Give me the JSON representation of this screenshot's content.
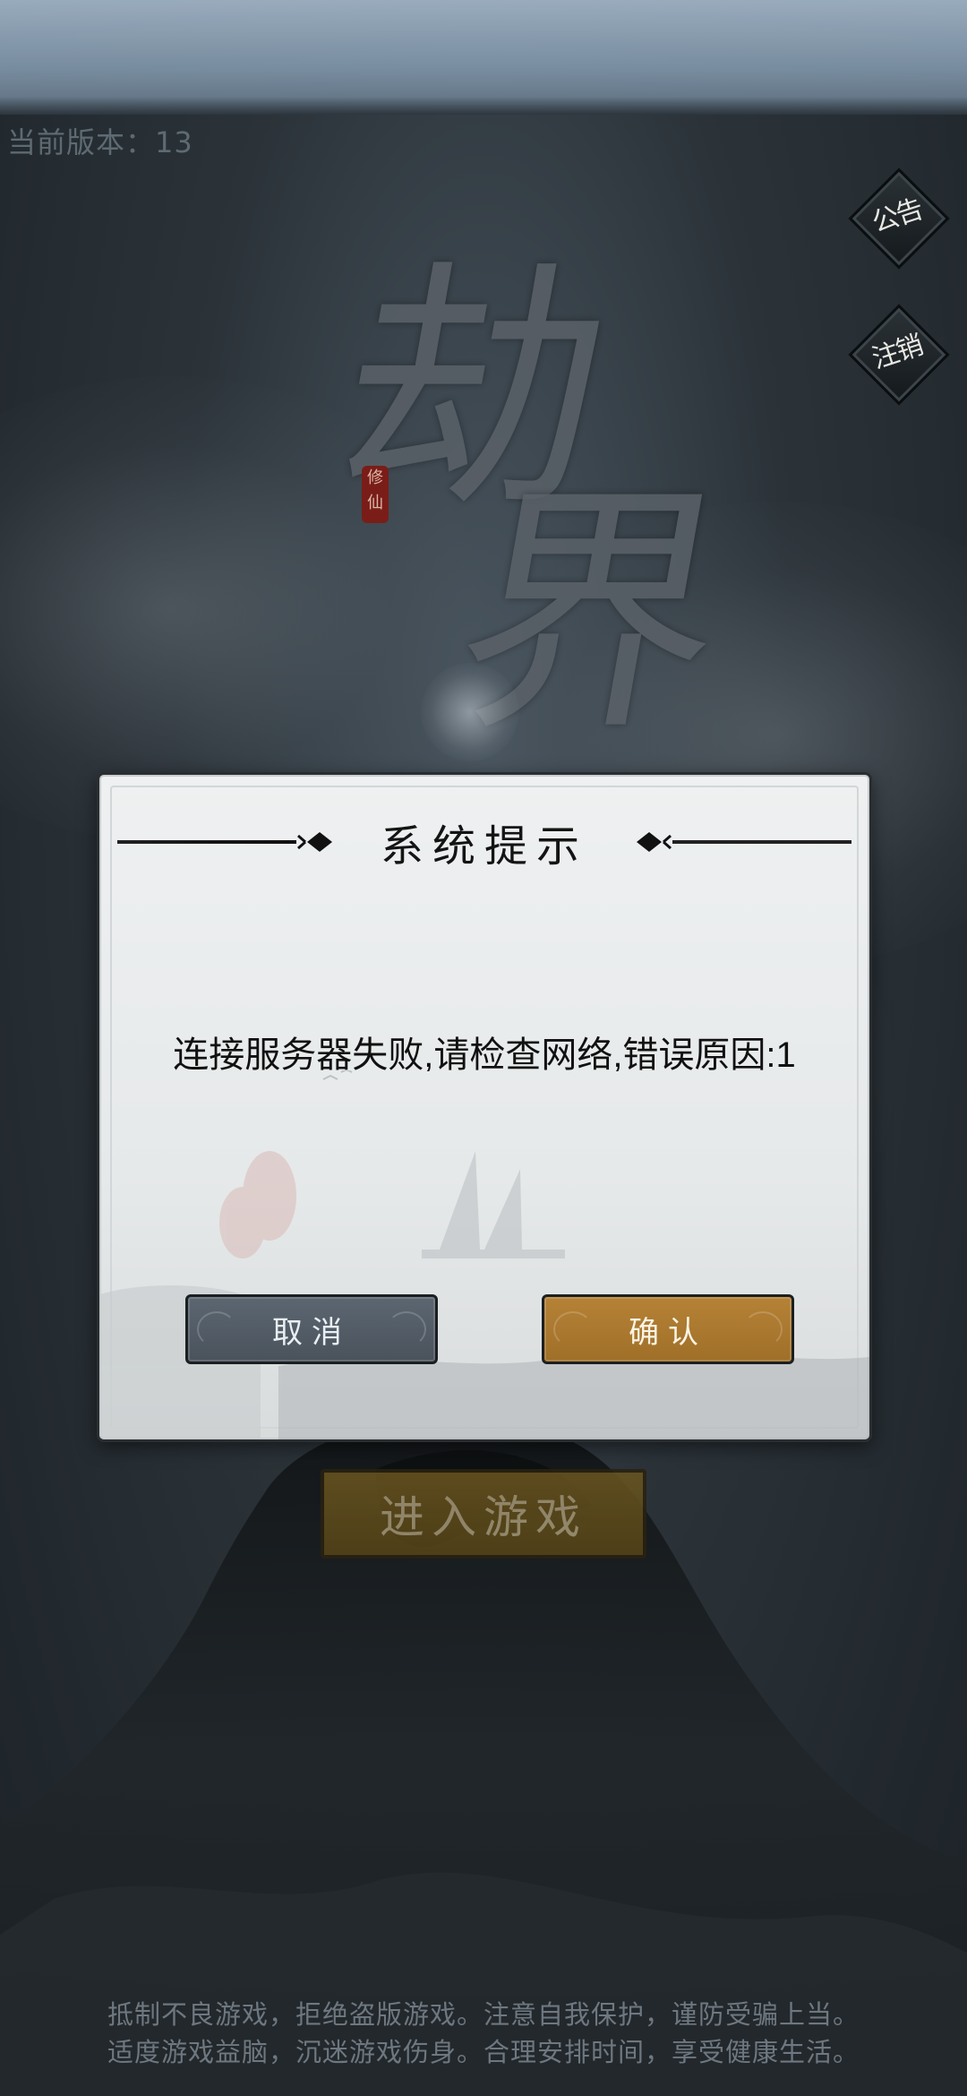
{
  "version_text": "当前版本：13",
  "side_buttons": {
    "notice": "公告",
    "logout": "注销"
  },
  "logo": {
    "glyph_1": "劫",
    "glyph_2": "界",
    "seal": "修仙"
  },
  "enter_game_label": "进入游戏",
  "dialog": {
    "title": "系统提示",
    "message": "连接服务器失败,请检查网络,错误原因:1",
    "cancel_label": "取消",
    "confirm_label": "确认"
  },
  "footer": {
    "line1": "抵制不良游戏，拒绝盗版游戏。注意自我保护，谨防受骗上当。",
    "line2": "适度游戏益脑，沉迷游戏伤身。合理安排时间，享受健康生活。"
  },
  "colors": {
    "confirm_button": "#a97a30",
    "cancel_button": "#545e68",
    "dialog_background": "#e8ebec"
  }
}
